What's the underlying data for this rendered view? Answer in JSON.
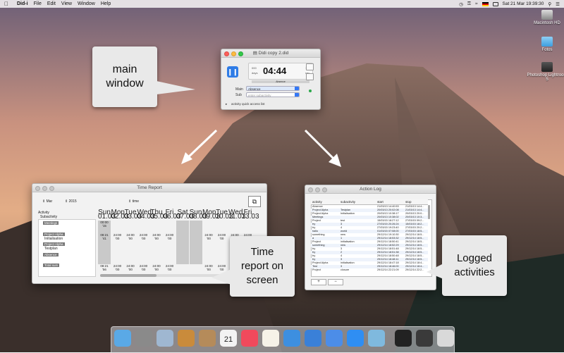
{
  "menubar": {
    "app_name": "Did-i",
    "items": [
      "File",
      "Edit",
      "View",
      "Window",
      "Help"
    ],
    "status": {
      "language_flag": "de-flag-icon",
      "clock": "Sat 21 Mar  19:39:30"
    }
  },
  "desktop_icons": [
    {
      "label": "Macintosh HD",
      "icon": "hard-drive-icon"
    },
    {
      "label": "Fotos",
      "icon": "folder-icon"
    },
    {
      "label": "Photoshop Lightroom 5",
      "icon": "lightroom-icon"
    }
  ],
  "main_window": {
    "title": "Didi copy 2.did",
    "time_small_left": "000",
    "time_small_left_unit": "days",
    "time": "04:44",
    "time_seconds": "11",
    "time_seconds_unit": "sec",
    "status_label": "Absence",
    "main_label": "Main",
    "main_value": "Absence",
    "sub_label": "Sub",
    "sub_placeholder": "enter subactivity",
    "quick_access": "activity quick access list"
  },
  "callouts": {
    "main": "main window",
    "time_report": "Time report on screen",
    "logged": "Logged activities"
  },
  "time_report": {
    "title": "Time Report",
    "month": "Mar",
    "year": "2015",
    "mode": "time",
    "activity_header": "Activity",
    "subactivity_header": "Subactivity",
    "rows": [
      {
        "label": "Meetings",
        "value": "00:00\n'15"
      },
      {
        "label": "Project Alpha",
        "value": "08:21\n'41"
      },
      {
        "label": "Initialisation",
        "value": ""
      },
      {
        "label": "Project Alpha",
        "value": ""
      },
      {
        "label": "Testplan",
        "value": ""
      },
      {
        "label": "Absence",
        "value": ""
      },
      {
        "label": "Total sum",
        "value": "08:21\n'56"
      }
    ],
    "days": [
      {
        "dow": "Sun",
        "date": "01.03"
      },
      {
        "dow": "Mon",
        "date": "02.03"
      },
      {
        "dow": "Tue",
        "date": "03.03"
      },
      {
        "dow": "Wed",
        "date": "04.03"
      },
      {
        "dow": "Thu",
        "date": "05.03"
      },
      {
        "dow": "Fri",
        "date": "06.03"
      },
      {
        "dow": "Sat",
        "date": "07.03"
      },
      {
        "dow": "Sun",
        "date": "08.03"
      },
      {
        "dow": "Mon",
        "date": "09.03"
      },
      {
        "dow": "Tue",
        "date": "10.03"
      },
      {
        "dow": "Wed",
        "date": "11.03"
      },
      {
        "dow": "Fri",
        "date": "13.03"
      }
    ],
    "cell_value": "24:00",
    "cell_sub": "'00"
  },
  "action_log": {
    "title": "Action Log",
    "columns": [
      "activity",
      "subactivity",
      "start",
      "stop"
    ],
    "rows": [
      [
        "Absence",
        "",
        "21/03/13 14:40:53",
        "21/03/13 14:4..."
      ],
      [
        "Project Alpha",
        "Testplan",
        "20/03/13 20:02:08",
        "21/03/13 14:4..."
      ],
      [
        "Project Alpha",
        "Initialisation",
        "20/03/13 10:38:17",
        "20/03/13 20:0..."
      ],
      [
        "Meetings",
        "",
        "20/03/13 10:38:02",
        "20/03/13 10:3..."
      ],
      [
        "Project",
        "test",
        "15/03/15 18:27:12",
        "27/03/15 09:2..."
      ],
      [
        "try",
        "3",
        "27/03/15 20:26:24",
        "15/03/15 18:2..."
      ],
      [
        "try",
        "4",
        "27/03/15 19:23:40",
        "27/03/15 20:2..."
      ],
      [
        "hallo",
        "world",
        "01/03/15 07:08:00",
        "27/03/15 18:5..."
      ],
      [
        "something",
        "new",
        "29/12/14 19:10:30",
        "29/12/14 18:5..."
      ],
      [
        "a",
        "1",
        "29/12/14 18:53:32",
        "29/12/14 18:5..."
      ],
      [
        "Project",
        "initialisation",
        "29/12/14 18:50:41",
        "29/12/14 18:5..."
      ],
      [
        "something",
        "new",
        "29/12/14 18:52:29",
        "29/12/14 18:5..."
      ],
      [
        "try",
        "3",
        "29/12/14 18:51:48",
        "29/12/14 18:5..."
      ],
      [
        "try",
        "2",
        "29/12/14 18:51:38",
        "29/12/14 18:5..."
      ],
      [
        "try",
        "4",
        "29/12/14 18:50:48",
        "29/12/14 18:5..."
      ],
      [
        "try",
        "3",
        "29/12/14 18:48:11",
        "29/12/14 18:5..."
      ],
      [
        "Project Alpha",
        "initialisation",
        "29/12/14 18:47:18",
        "29/12/14 18:4..."
      ],
      [
        "Test",
        "3",
        "29/12/14 18:46:00",
        "29/12/14 18:4..."
      ],
      [
        "Project",
        "closure",
        "29/12/14 22:21:09",
        "29/12/14 22:2..."
      ]
    ],
    "add": "+",
    "remove": "−"
  },
  "dock": [
    "finder-icon",
    "system-preferences-icon",
    "launchpad-icon",
    "preview-icon",
    "contacts-icon",
    "calendar-icon",
    "music-icon",
    "photos-icon",
    "safari-icon",
    "keynote-icon",
    "xcode-icon",
    "app-store-icon",
    "maps-icon",
    "terminal-icon",
    "photo-booth-icon",
    "trash-icon"
  ],
  "calendar_day": "21"
}
